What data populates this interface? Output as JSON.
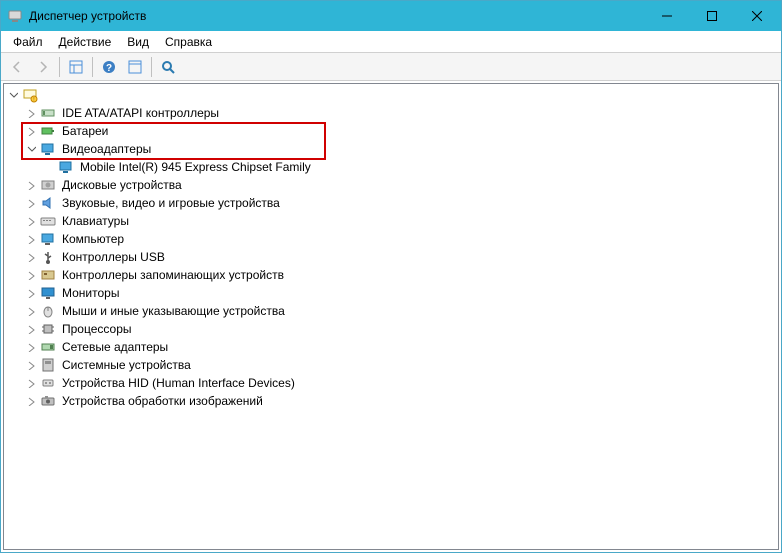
{
  "title": "Диспетчер устройств",
  "menu": {
    "file": "Файл",
    "action": "Действие",
    "view": "Вид",
    "help": "Справка"
  },
  "tree": {
    "root": {
      "label": ""
    },
    "ide": {
      "label": "IDE ATA/ATAPI контроллеры"
    },
    "batteries": {
      "label": "Батареи"
    },
    "display": {
      "label": "Видеоадаптеры"
    },
    "display_child": {
      "label": "Mobile Intel(R) 945 Express Chipset Family"
    },
    "disk": {
      "label": "Дисковые устройства"
    },
    "sound": {
      "label": "Звуковые, видео и игровые устройства"
    },
    "keyboard": {
      "label": "Клавиатуры"
    },
    "computer": {
      "label": "Компьютер"
    },
    "usb": {
      "label": "Контроллеры USB"
    },
    "storage": {
      "label": "Контроллеры запоминающих устройств"
    },
    "monitor": {
      "label": "Мониторы"
    },
    "mouse": {
      "label": "Мыши и иные указывающие устройства"
    },
    "processor": {
      "label": "Процессоры"
    },
    "network": {
      "label": "Сетевые адаптеры"
    },
    "system": {
      "label": "Системные устройства"
    },
    "hid": {
      "label": "Устройства HID (Human Interface Devices)"
    },
    "imaging": {
      "label": "Устройства обработки изображений"
    }
  }
}
